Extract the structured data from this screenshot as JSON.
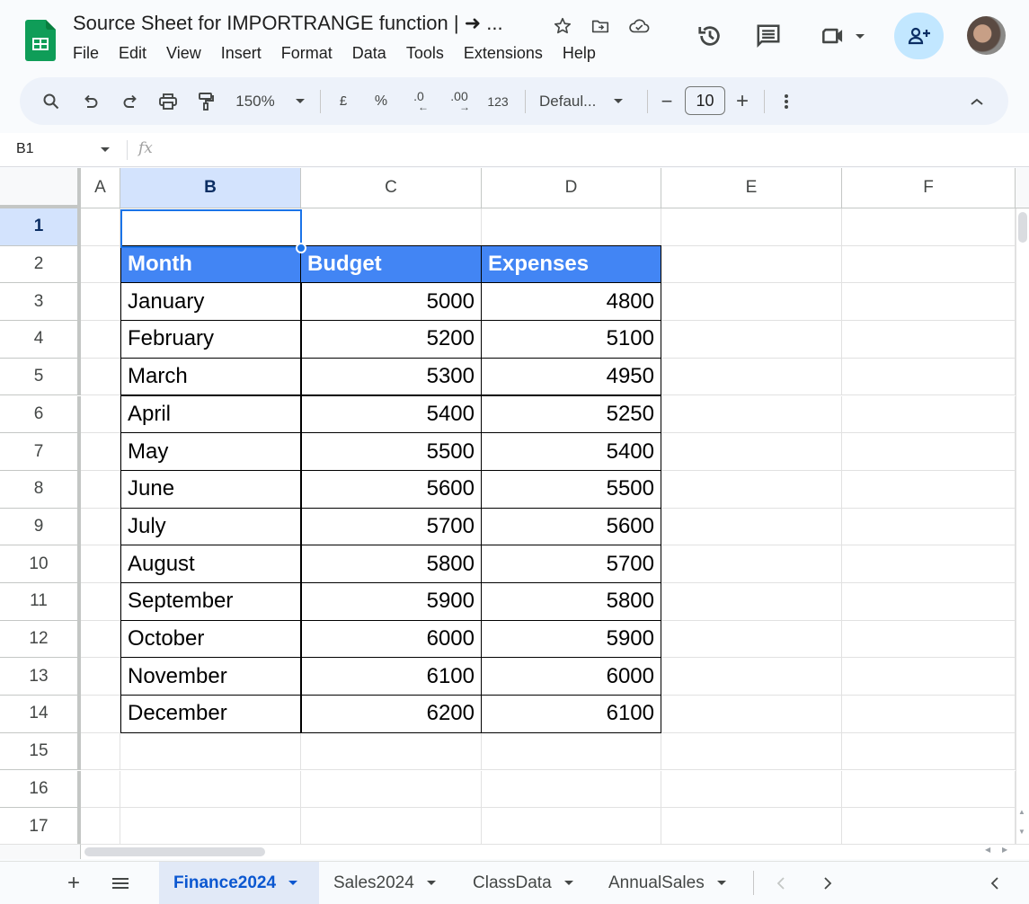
{
  "app": {
    "title": "Source Sheet for IMPORTRANGE function | ➜ ...",
    "menu": [
      "File",
      "Edit",
      "View",
      "Insert",
      "Format",
      "Data",
      "Tools",
      "Extensions",
      "Help"
    ],
    "brand_color": "#0f9d58",
    "accent_color": "#1a73e8"
  },
  "header_icons": {
    "star": "star-icon",
    "move": "move-to-folder-icon",
    "cloud": "cloud-saved-icon",
    "history": "version-history-icon",
    "comments": "comments-icon",
    "meet": "video-call-icon",
    "share": "add-person-icon",
    "avatar": "user-avatar"
  },
  "toolbar": {
    "zoom": "150%",
    "currency": "£",
    "percent": "%",
    "decrease_decimal": ".0",
    "increase_decimal": ".00",
    "number_format": "123",
    "font": "Defaul...",
    "font_size": "10",
    "minus": "−",
    "plus": "+"
  },
  "formula_bar": {
    "name_box": "B1",
    "fx": "fx",
    "formula": ""
  },
  "grid": {
    "columns": [
      "A",
      "B",
      "C",
      "D",
      "E",
      "F"
    ],
    "selected_column": "B",
    "rows": [
      "1",
      "2",
      "3",
      "4",
      "5",
      "6",
      "7",
      "8",
      "9",
      "10",
      "11",
      "12",
      "13",
      "14",
      "15",
      "16",
      "17"
    ],
    "selected_row": "1",
    "selected_cell": "B1",
    "header_fill": "#4285f4"
  },
  "table": {
    "headers": [
      "Month",
      "Budget",
      "Expenses"
    ],
    "rows": [
      [
        "January",
        "5000",
        "4800"
      ],
      [
        "February",
        "5200",
        "5100"
      ],
      [
        "March",
        "5300",
        "4950"
      ],
      [
        "April",
        "5400",
        "5250"
      ],
      [
        "May",
        "5500",
        "5400"
      ],
      [
        "June",
        "5600",
        "5500"
      ],
      [
        "July",
        "5700",
        "5600"
      ],
      [
        "August",
        "5800",
        "5700"
      ],
      [
        "September",
        "5900",
        "5800"
      ],
      [
        "October",
        "6000",
        "5900"
      ],
      [
        "November",
        "6100",
        "6000"
      ],
      [
        "December",
        "6200",
        "6100"
      ]
    ]
  },
  "sheets": {
    "tabs": [
      "Finance2024",
      "Sales2024",
      "ClassData",
      "AnnualSales"
    ],
    "active": "Finance2024"
  }
}
